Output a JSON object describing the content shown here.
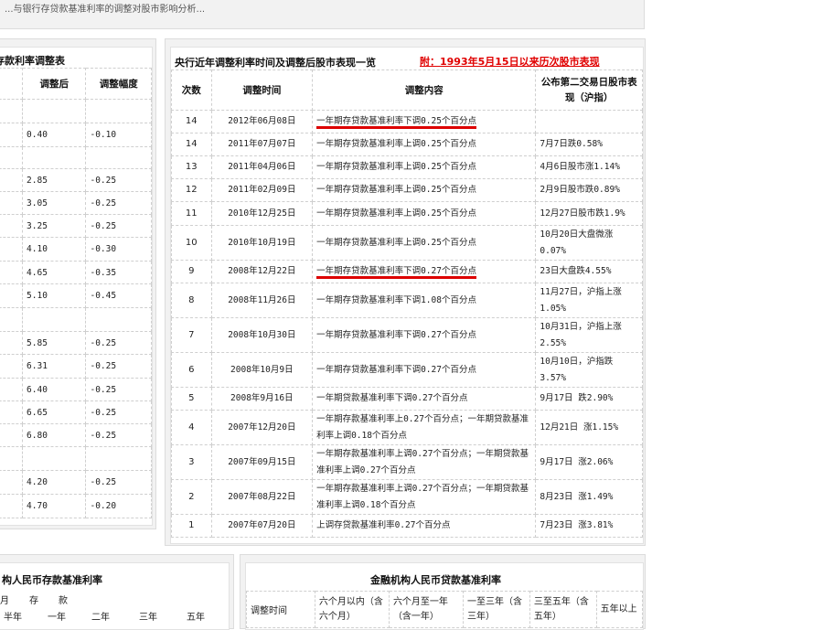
{
  "top_text": "...与银行存贷款基准利率的调整对股市影响分析...",
  "left_panel": {
    "title": "存款利率调整表",
    "headers": [
      "调整后",
      "调整幅度"
    ],
    "rows": [
      {
        "after": "",
        "delta": ""
      },
      {
        "after": "0.40",
        "delta": "-0.10"
      },
      {
        "after": "",
        "delta": ""
      },
      {
        "after": "2.85",
        "delta": "-0.25"
      },
      {
        "after": "3.05",
        "delta": "-0.25"
      },
      {
        "after": "3.25",
        "delta": "-0.25"
      },
      {
        "after": "4.10",
        "delta": "-0.30"
      },
      {
        "after": "4.65",
        "delta": "-0.35"
      },
      {
        "after": "5.10",
        "delta": "-0.45"
      },
      {
        "after": "",
        "delta": ""
      },
      {
        "after": "5.85",
        "delta": "-0.25"
      },
      {
        "after": "6.31",
        "delta": "-0.25"
      },
      {
        "after": "6.40",
        "delta": "-0.25"
      },
      {
        "after": "6.65",
        "delta": "-0.25"
      },
      {
        "after": "6.80",
        "delta": "-0.25"
      },
      {
        "after": "",
        "delta": ""
      },
      {
        "after": "4.20",
        "delta": "-0.25"
      },
      {
        "after": "4.70",
        "delta": "-0.20"
      }
    ]
  },
  "right_panel": {
    "title": "央行近年调整利率时间及调整后股市表现一览",
    "link": "附：1993年5月15日以来历次股市表现",
    "headers": [
      "次数",
      "调整时间",
      "调整内容",
      "公布第二交易日股市表现（沪指）"
    ],
    "rows": [
      {
        "n": "14",
        "date": "2012年06月08日",
        "content": "一年期存贷款基准利率下调0.25个百分点",
        "market": ""
      },
      {
        "n": "14",
        "date": "2011年07月07日",
        "content": "一年期存贷款基准利率上调0.25个百分点",
        "market": "7月7日跌0.58%"
      },
      {
        "n": "13",
        "date": "2011年04月06日",
        "content": "一年期存贷款基准利率上调0.25个百分点",
        "market": "4月6日股市涨1.14%"
      },
      {
        "n": "12",
        "date": "2011年02月09日",
        "content": "一年期存贷款基准利率上调0.25个百分点",
        "market": "2月9日股市跌0.89%"
      },
      {
        "n": "11",
        "date": "2010年12月25日",
        "content": "一年期存贷款基准利率上调0.25个百分点",
        "market": "12月27日股市跌1.9%"
      },
      {
        "n": "10",
        "date": "2010年10月19日",
        "content": "一年期存贷款基准利率上调0.25个百分点",
        "market": "10月20日大盘微涨0.07%"
      },
      {
        "n": "9",
        "date": "2008年12月22日",
        "content": "一年期存贷款基准利率下调0.27个百分点",
        "market": "23日大盘跌4.55%"
      },
      {
        "n": "8",
        "date": "2008年11月26日",
        "content": "一年期存贷款基准利率下调1.08个百分点",
        "market": "11月27日，沪指上涨1.05%"
      },
      {
        "n": "7",
        "date": "2008年10月30日",
        "content": "一年期存贷款基准利率下调0.27个百分点",
        "market": "10月31日，沪指上涨2.55%"
      },
      {
        "n": "6",
        "date": "2008年10月9日",
        "content": "一年期存贷款基准利率下调0.27个百分点",
        "market": "10月10日，沪指跌3.57%"
      },
      {
        "n": "5",
        "date": "2008年9月16日",
        "content": "一年期贷款基准利率下调0.27个百分点",
        "market": "9月17日 跌2.90%"
      },
      {
        "n": "4",
        "date": "2007年12月20日",
        "content": "一年期存款基准利率上0.27个百分点；一年期贷款基准利率上调0.18个百分点",
        "market": "12月21日 涨1.15%"
      },
      {
        "n": "3",
        "date": "2007年09月15日",
        "content": "一年期存款基准利率上调0.27个百分点；一年期贷款基准利率上调0.27个百分点",
        "market": "9月17日 涨2.06%"
      },
      {
        "n": "2",
        "date": "2007年08月22日",
        "content": "一年期存款基准利率上调0.27个百分点；一年期贷款基准利率上调0.18个百分点",
        "market": "8月23日 涨1.49%"
      },
      {
        "n": "1",
        "date": "2007年07月20日",
        "content": "上调存贷款基准利率0.27个百分点",
        "market": "7月23日 涨3.81%"
      }
    ]
  },
  "bottom_left": {
    "title": "构人民币存款基准利率",
    "row1": [
      "月",
      "存",
      "款"
    ],
    "row2": [
      "半年",
      "一年",
      "二年",
      "三年",
      "五年"
    ]
  },
  "bottom_right": {
    "title": "金融机构人民币贷款基准利率",
    "col0": "调整时间",
    "headers": [
      "六个月以内（含六个月）",
      "六个月至一年（含一年）",
      "一至三年（含三年）",
      "三至五年（含五年）",
      "五年以上"
    ]
  }
}
